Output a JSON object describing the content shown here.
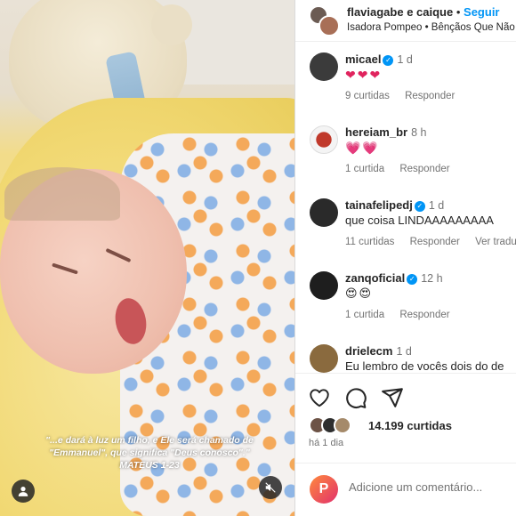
{
  "post": {
    "author": "flaviagabe e caique",
    "follow_label": "Seguir",
    "audio": "Isadora Pompeo • Bênçãos Que Não",
    "caption_lines": [
      "\"...e dará à luz um filho, e Ele será chamado de",
      "\"Emmanuel\", que significa \"Deus conosco\".\"",
      "MATEUS 1-23"
    ]
  },
  "comments": [
    {
      "user": "micael",
      "verified": true,
      "time": "1 d",
      "text": "❤❤❤",
      "kind": "hearts",
      "likes": "9 curtidas",
      "reply": "Responder",
      "translate": "",
      "avatar_color": "#3b3b3b"
    },
    {
      "user": "hereiam_br",
      "verified": false,
      "time": "8 h",
      "text": "💗💗",
      "kind": "hearts",
      "likes": "1 curtida",
      "reply": "Responder",
      "translate": "",
      "avatar_color": "#c0392b"
    },
    {
      "user": "tainafelipedj",
      "verified": true,
      "time": "1 d",
      "text": "que coisa LINDAAAAAAAAA",
      "kind": "text",
      "likes": "11 curtidas",
      "reply": "Responder",
      "translate": "Ver tradução",
      "avatar_color": "#2a2a2a"
    },
    {
      "user": "zanqoficial",
      "verified": true,
      "time": "12 h",
      "text": "😍😍",
      "kind": "eyes",
      "likes": "1 curtida",
      "reply": "Responder",
      "translate": "",
      "avatar_color": "#1e1e1e"
    },
    {
      "user": "drielecm",
      "verified": false,
      "time": "1 d",
      "text": "Eu lembro de vocês dois do de",
      "kind": "text",
      "likes": "",
      "reply": "",
      "translate": "",
      "avatar_color": "#8a6a3e"
    }
  ],
  "actions": {
    "likes_count": "14.199",
    "likes_label": "curtidas",
    "time_ago": "há 1 dia"
  },
  "add_comment": {
    "placeholder": "Adicione um comentário..."
  },
  "icons": [
    "like-icon",
    "comment-icon",
    "share-icon",
    "user-tag-icon",
    "mute-icon",
    "verified-icon"
  ]
}
